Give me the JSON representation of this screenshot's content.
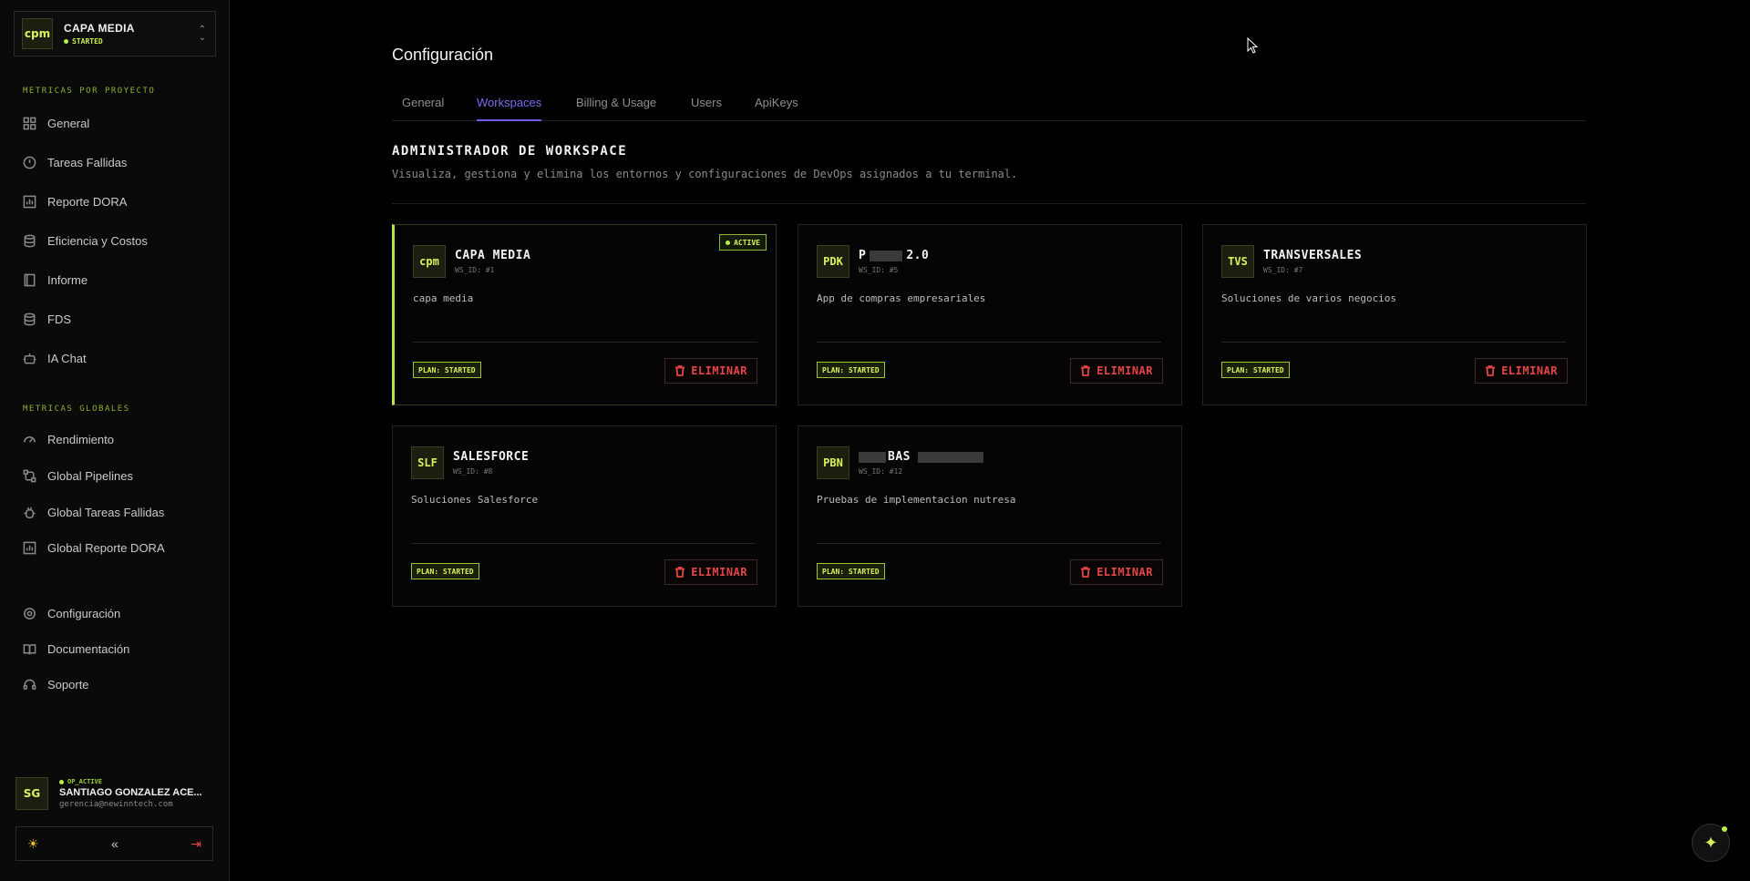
{
  "project": {
    "name": "CAPA MEDIA",
    "status": "STARTED",
    "logo": "cpm"
  },
  "sidebar": {
    "section1": "METRICAS POR PROYECTO",
    "items1": [
      {
        "label": "General",
        "icon": "grid-icon"
      },
      {
        "label": "Tareas Fallidas",
        "icon": "alert-circle-icon"
      },
      {
        "label": "Reporte DORA",
        "icon": "bar-chart-icon"
      },
      {
        "label": "Eficiencia y Costos",
        "icon": "database-icon"
      },
      {
        "label": "Informe",
        "icon": "book-icon"
      },
      {
        "label": "FDS",
        "icon": "database-icon"
      },
      {
        "label": "IA Chat",
        "icon": "bot-icon"
      }
    ],
    "section2": "METRICAS GLOBALES",
    "items2": [
      {
        "label": "Rendimiento",
        "icon": "gauge-icon"
      },
      {
        "label": "Global Pipelines",
        "icon": "workflow-icon"
      },
      {
        "label": "Global Tareas Fallidas",
        "icon": "bug-icon"
      },
      {
        "label": "Global Reporte DORA",
        "icon": "bar-chart-icon"
      }
    ],
    "items3": [
      {
        "label": "Configuración",
        "icon": "gear-icon"
      },
      {
        "label": "Documentación",
        "icon": "book-open-icon"
      },
      {
        "label": "Soporte",
        "icon": "headset-icon"
      }
    ]
  },
  "user": {
    "initials": "SG",
    "status": "OP_ACTIVE",
    "name": "SANTIAGO GONZALEZ ACE...",
    "email": "gerencia@newinntech.com"
  },
  "bottom_bar": {
    "theme_icon": "☀",
    "collapse_icon": "«",
    "logout_icon": "⇥"
  },
  "page": {
    "title": "Configuración"
  },
  "tabs": [
    {
      "label": "General",
      "active": false
    },
    {
      "label": "Workspaces",
      "active": true
    },
    {
      "label": "Billing & Usage",
      "active": false
    },
    {
      "label": "Users",
      "active": false
    },
    {
      "label": "ApiKeys",
      "active": false
    }
  ],
  "admin": {
    "title": "ADMINISTRADOR DE WORKSPACE",
    "description": "Visualiza, gestiona y elimina los entornos y configuraciones de DevOps asignados a tu terminal."
  },
  "workspaces": [
    {
      "logo": "cpm",
      "name": "CAPA MEDIA",
      "ws_id": "WS_ID: #1",
      "description": "capa media",
      "plan": "PLAN: STARTED",
      "delete": "ELIMINAR",
      "active": true,
      "active_label": "ACTIVE"
    },
    {
      "logo": "PDK",
      "name_prefix": "P",
      "name_suffix": "2.0",
      "ws_id": "WS_ID: #5",
      "description": "App de compras empresariales",
      "plan": "PLAN: STARTED",
      "delete": "ELIMINAR"
    },
    {
      "logo": "TVS",
      "name": "TRANSVERSALES",
      "ws_id": "WS_ID: #7",
      "description": "Soluciones de varios negocios",
      "plan": "PLAN: STARTED",
      "delete": "ELIMINAR"
    },
    {
      "logo": "SLF",
      "name": "SALESFORCE",
      "ws_id": "WS_ID: #8",
      "description": "Soluciones Salesforce",
      "plan": "PLAN: STARTED",
      "delete": "ELIMINAR"
    },
    {
      "logo": "PBN",
      "name_suffix": "BAS",
      "ws_id": "WS_ID: #12",
      "description": "Pruebas de implementacion nutresa",
      "plan": "PLAN: STARTED",
      "delete": "ELIMINAR"
    }
  ],
  "colors": {
    "accent": "#d7f35c",
    "tab_active": "#6c5ce7",
    "danger": "#e64545",
    "background": "#000000"
  }
}
